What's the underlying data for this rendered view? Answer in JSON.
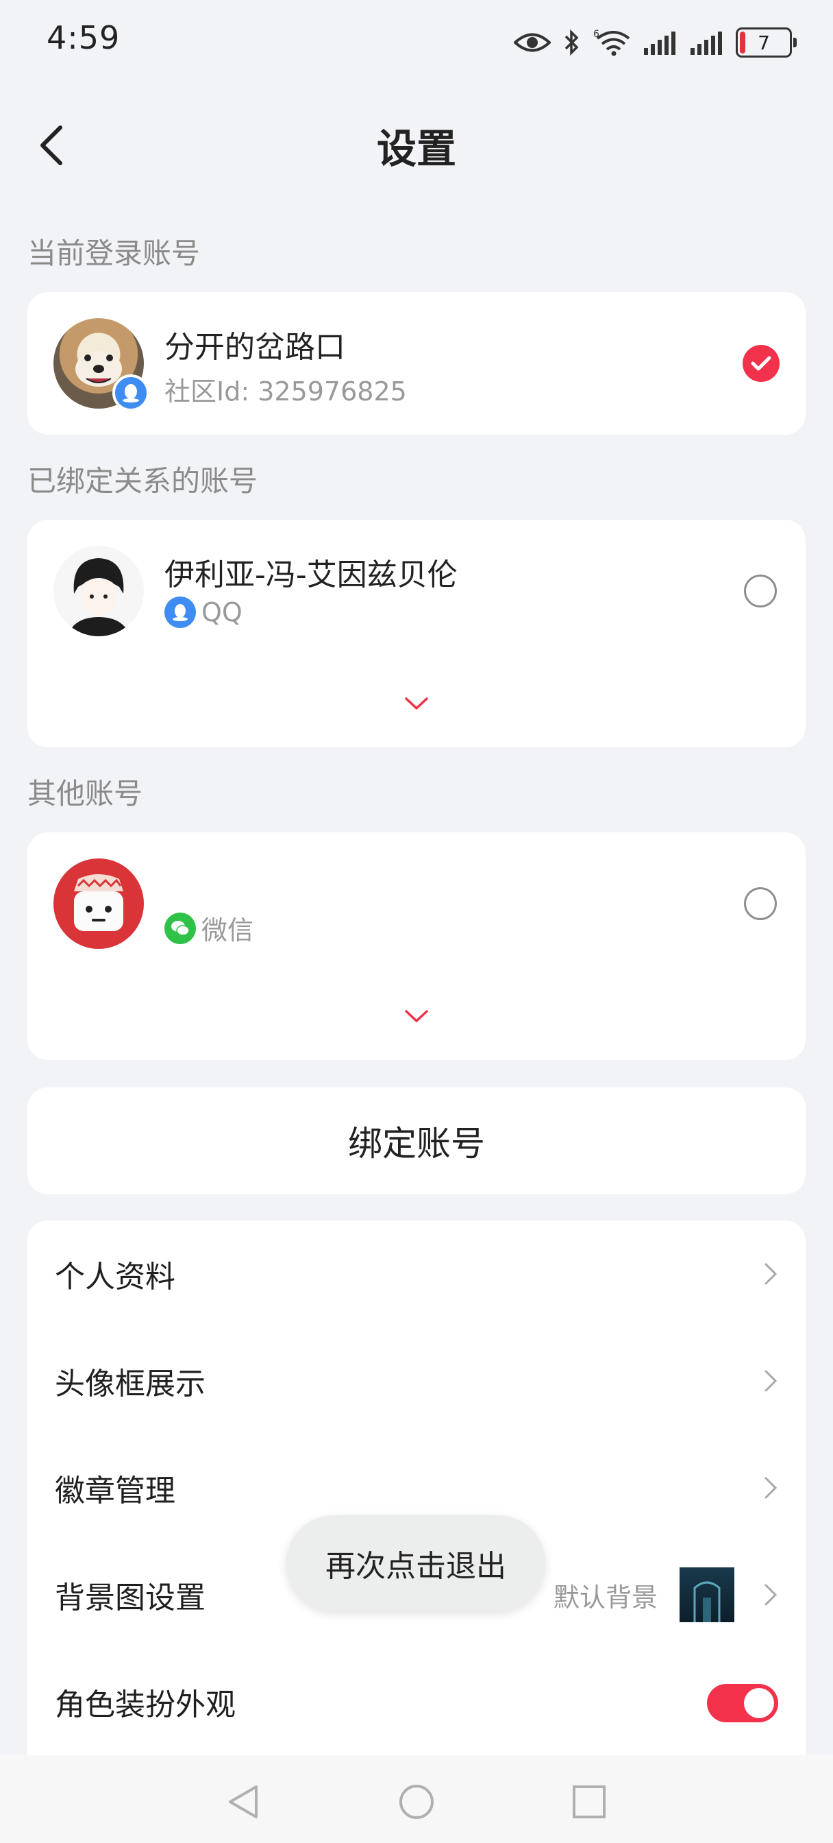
{
  "status_bar": {
    "time": "4:59",
    "battery_level": "7",
    "icons": [
      "eye-icon",
      "bluetooth-icon",
      "wifi-6-icon",
      "signal-icon",
      "signal-icon",
      "battery-icon"
    ]
  },
  "header": {
    "title": "设置",
    "back_icon": "chevron-left-icon"
  },
  "current_account": {
    "section_label": "当前登录账号",
    "name": "分开的岔路口",
    "community_id": "社区Id: 325976825",
    "selected": true,
    "login_badge": "qq-icon"
  },
  "bound_accounts": {
    "section_label": "已绑定关系的账号",
    "items": [
      {
        "name": "伊利亚-冯-艾因兹贝伦",
        "platform": "QQ",
        "platform_icon": "qq-icon",
        "selected": false
      }
    ],
    "expand_icon": "chevron-down-icon"
  },
  "other_accounts": {
    "section_label": "其他账号",
    "items": [
      {
        "name": "",
        "platform": "微信",
        "platform_icon": "wechat-icon",
        "selected": false
      }
    ],
    "expand_icon": "chevron-down-icon"
  },
  "bind_button": {
    "label": "绑定账号"
  },
  "menu": {
    "items": [
      {
        "label": "个人资料"
      },
      {
        "label": "头像框展示"
      },
      {
        "label": "徽章管理"
      },
      {
        "label": "背景图设置",
        "value": "默认背景"
      },
      {
        "label": "角色装扮外观",
        "toggle_on": true
      }
    ]
  },
  "toast": {
    "text": "再次点击退出"
  },
  "colors": {
    "accent": "#f1324a",
    "background": "#f2f3f7",
    "card": "#ffffff"
  },
  "nav_bar": {
    "icons": [
      "back-triangle-icon",
      "home-circle-icon",
      "recents-square-icon"
    ]
  }
}
